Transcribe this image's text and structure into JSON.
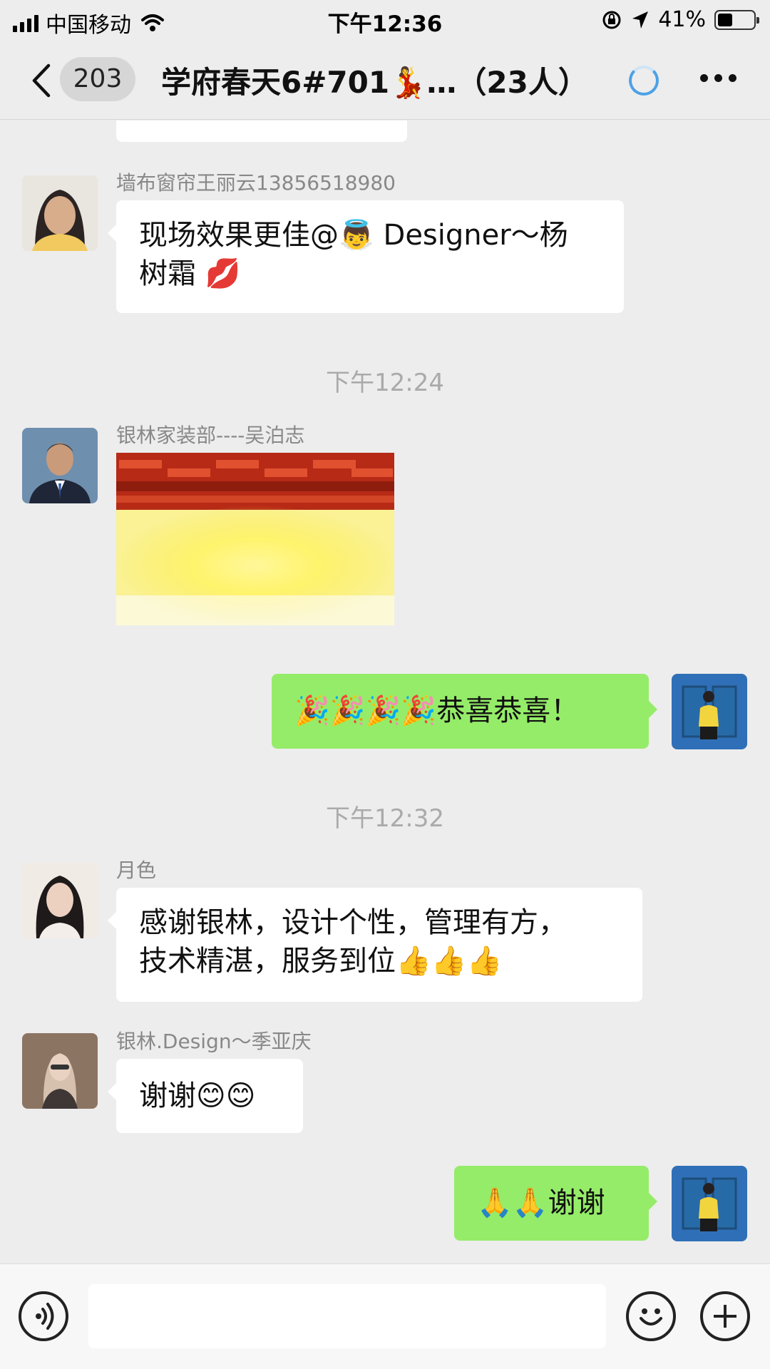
{
  "status_bar": {
    "carrier": "中国移动",
    "time": "下午12:36",
    "battery_percent": "41%",
    "battery_level": 0.41
  },
  "nav": {
    "unread_count": "203",
    "title": "学府春天6#701💃…（23人）"
  },
  "messages": [
    {
      "sender": "墙布窗帘王丽云13856518980",
      "text_line1": "现场效果更佳@👼 Designer～杨",
      "text_line2": "树霜 💋"
    },
    {
      "timestamp": "下午12:24"
    },
    {
      "sender": "银林家装部----吴泊志",
      "kind": "firecracker-sticker"
    },
    {
      "text": "🎉🎉🎉🎉恭喜恭喜！"
    },
    {
      "timestamp": "下午12:32"
    },
    {
      "sender": "月色",
      "text_line1": "感谢银林，设计个性，管理有方，",
      "text_line2": "技术精湛，服务到位👍👍👍"
    },
    {
      "sender": "银林.Design～季亚庆",
      "text": "谢谢😊😊"
    },
    {
      "text": "🙏🙏谢谢"
    }
  ],
  "colors": {
    "background": "#ededed",
    "incoming_bubble": "#ffffff",
    "outgoing_bubble": "#95ec69",
    "loading_accent": "#4ca1e6"
  },
  "icons": [
    "back-icon",
    "loading-icon",
    "more-icon",
    "voice-icon",
    "emoji-icon",
    "plus-icon"
  ]
}
